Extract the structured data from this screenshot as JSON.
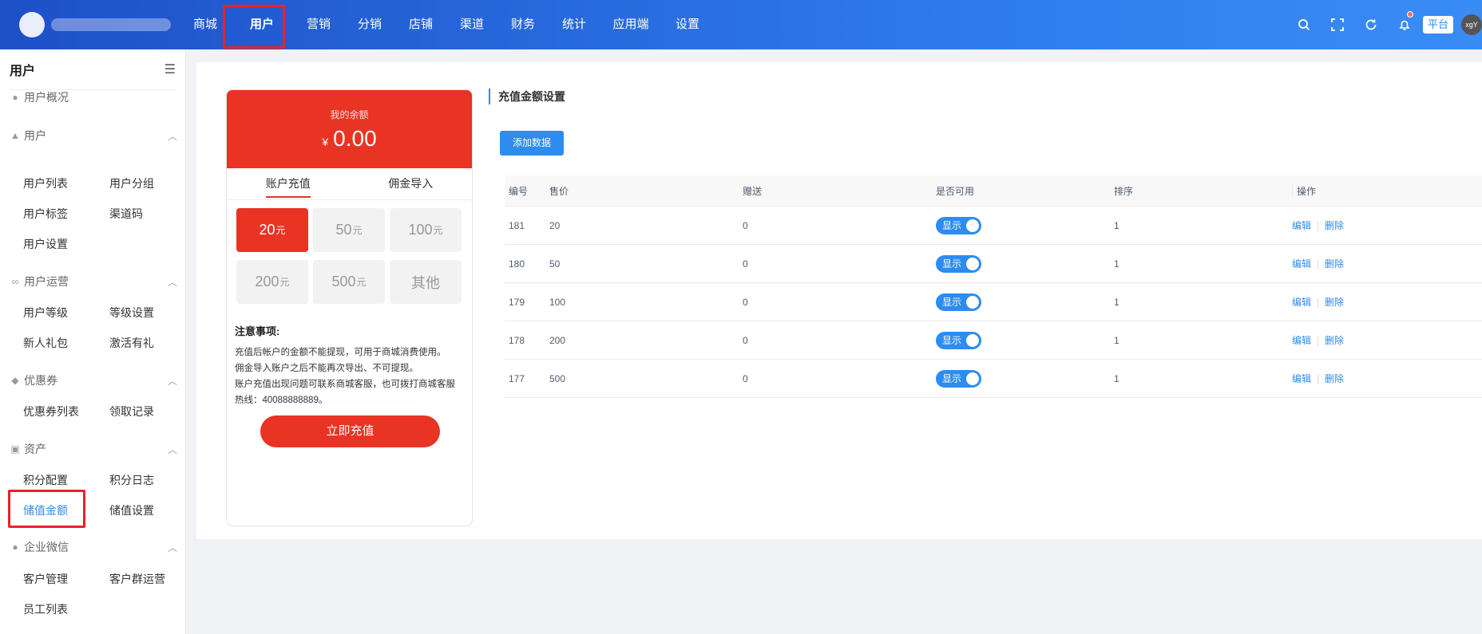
{
  "topnav": {
    "items": [
      "商城",
      "用户",
      "营销",
      "分销",
      "店铺",
      "渠道",
      "财务",
      "统计",
      "应用端",
      "设置"
    ],
    "active": "用户",
    "icons": [
      "search-icon",
      "fullscreen-icon",
      "refresh-icon",
      "bell-icon"
    ],
    "platform_tag": "平台",
    "avatar_text": "xgY"
  },
  "sidebar": {
    "title": "用户",
    "top_item": "用户概况",
    "groups": [
      {
        "label": "用户",
        "icon": "user-icon",
        "items": [
          "用户列表",
          "用户分组",
          "用户标签",
          "渠道码",
          "用户设置"
        ]
      },
      {
        "label": "用户运营",
        "icon": "link-icon",
        "items": [
          "用户等级",
          "等级设置",
          "新人礼包",
          "激活有礼"
        ]
      },
      {
        "label": "优惠券",
        "icon": "coupon-icon",
        "items": [
          "优惠券列表",
          "领取记录"
        ]
      },
      {
        "label": "资产",
        "icon": "asset-icon",
        "items": [
          "积分配置",
          "积分日志",
          "储值金额",
          "储值设置"
        ]
      },
      {
        "label": "企业微信",
        "icon": "wechat-icon",
        "items": [
          "客户管理",
          "客户群运营",
          "员工列表"
        ]
      }
    ],
    "active_item": "储值金额"
  },
  "preview": {
    "balance_label": "我的余额",
    "currency": "¥",
    "balance": "0.00",
    "tabs": [
      "账户充值",
      "佣金导入"
    ],
    "unit": "元",
    "amounts": [
      "20",
      "50",
      "100",
      "200",
      "500"
    ],
    "other_label": "其他",
    "notice_title": "注意事项:",
    "notice_lines": [
      "充值后帐户的金额不能提现，可用于商城消费使用。",
      "佣金导入账户之后不能再次导出、不可提现。",
      "账户充值出现问题可联系商城客服，也可拨打商城客服",
      "热线：40088888889。"
    ],
    "button": "立即充值"
  },
  "panel": {
    "title": "充值金额设置",
    "add_button": "添加数据",
    "columns": [
      "编号",
      "售价",
      "赠送",
      "是否可用",
      "排序",
      "操作"
    ],
    "switch_label": "显示",
    "action_edit": "编辑",
    "action_delete": "删除",
    "rows": [
      {
        "id": "181",
        "price": "20",
        "gift": "0",
        "sort": "1"
      },
      {
        "id": "180",
        "price": "50",
        "gift": "0",
        "sort": "1"
      },
      {
        "id": "179",
        "price": "100",
        "gift": "0",
        "sort": "1"
      },
      {
        "id": "178",
        "price": "200",
        "gift": "0",
        "sort": "1"
      },
      {
        "id": "177",
        "price": "500",
        "gift": "0",
        "sort": "1"
      }
    ]
  },
  "colors": {
    "primary": "#2d8cf0",
    "accent_red": "#e93323",
    "highlight_box": "#e8222a"
  }
}
